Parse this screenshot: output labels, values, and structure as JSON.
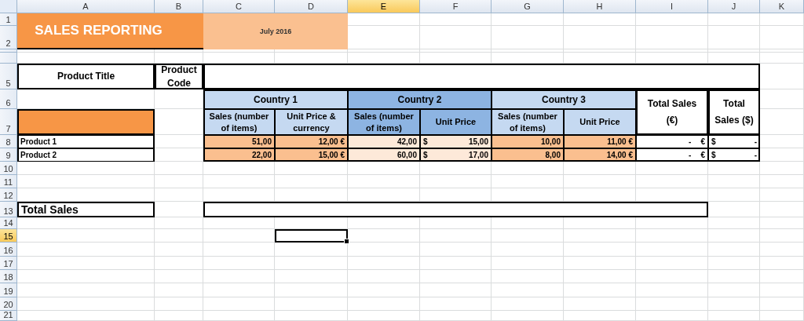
{
  "columns": [
    {
      "label": "A",
      "selected": false
    },
    {
      "label": "B",
      "selected": false
    },
    {
      "label": "C",
      "selected": false
    },
    {
      "label": "D",
      "selected": false
    },
    {
      "label": "E",
      "selected": true
    },
    {
      "label": "F",
      "selected": false
    },
    {
      "label": "G",
      "selected": false
    },
    {
      "label": "H",
      "selected": false
    },
    {
      "label": "I",
      "selected": false
    },
    {
      "label": "J",
      "selected": false
    },
    {
      "label": "K",
      "selected": false
    }
  ],
  "rows": [
    {
      "label": "1",
      "selected": false
    },
    {
      "label": "2",
      "selected": false
    },
    {
      "label": "",
      "selected": false
    },
    {
      "label": "",
      "selected": false
    },
    {
      "label": "5",
      "selected": false
    },
    {
      "label": "6",
      "selected": false
    },
    {
      "label": "7",
      "selected": false
    },
    {
      "label": "8",
      "selected": false
    },
    {
      "label": "9",
      "selected": false
    },
    {
      "label": "10",
      "selected": false
    },
    {
      "label": "11",
      "selected": false
    },
    {
      "label": "12",
      "selected": false
    },
    {
      "label": "13",
      "selected": false
    },
    {
      "label": "14",
      "selected": false
    },
    {
      "label": "15",
      "selected": true
    },
    {
      "label": "16",
      "selected": false
    },
    {
      "label": "17",
      "selected": false
    },
    {
      "label": "18",
      "selected": false
    },
    {
      "label": "19",
      "selected": false
    },
    {
      "label": "20",
      "selected": false
    },
    {
      "label": "21",
      "selected": false
    }
  ],
  "title": "SALES REPORTING",
  "date": "July 2016",
  "product_title": "Product Title",
  "product_code": "Product Code",
  "countries": [
    {
      "name": "Country 1",
      "color": "#c5d9f1",
      "subheaders": [
        "Sales (number of items)",
        "Unit Price & currency"
      ]
    },
    {
      "name": "Country 2",
      "color": "#8db4e2",
      "subheaders": [
        "Sales (number of items)",
        "Unit Price"
      ]
    },
    {
      "name": "Country 3",
      "color": "#c5d9f1",
      "subheaders": [
        "Sales (number of items)",
        "Unit Price"
      ]
    }
  ],
  "total_eur_label": "Total Sales (€)",
  "total_usd_label": "Total Sales ($)",
  "products": [
    {
      "name": "Product 1",
      "values": [
        {
          "text": "51,00",
          "color": "#fabf8f"
        },
        {
          "text": "12,00 €",
          "color": "#fabf8f"
        },
        {
          "text": "42,00",
          "color": "#fde9d9"
        },
        {
          "prefix": "$",
          "text": "15,00",
          "color": "#fde9d9"
        },
        {
          "text": "10,00",
          "color": "#fabf8f"
        },
        {
          "text": "11,00 €",
          "color": "#fabf8f"
        }
      ],
      "total_eur": {
        "text": "-",
        "suffix": "€"
      },
      "total_usd": {
        "prefix": "$",
        "text": "-"
      }
    },
    {
      "name": "Product 2",
      "values": [
        {
          "text": "22,00",
          "color": "#fabf8f"
        },
        {
          "text": "15,00 €",
          "color": "#fabf8f"
        },
        {
          "text": "60,00",
          "color": "#fde9d9"
        },
        {
          "prefix": "$",
          "text": "17,00",
          "color": "#fde9d9"
        },
        {
          "text": "8,00",
          "color": "#fabf8f"
        },
        {
          "text": "14,00 €",
          "color": "#fabf8f"
        }
      ],
      "total_eur": {
        "text": "-",
        "suffix": "€"
      },
      "total_usd": {
        "prefix": "$",
        "text": "-"
      }
    }
  ],
  "total_sales": "Total Sales"
}
